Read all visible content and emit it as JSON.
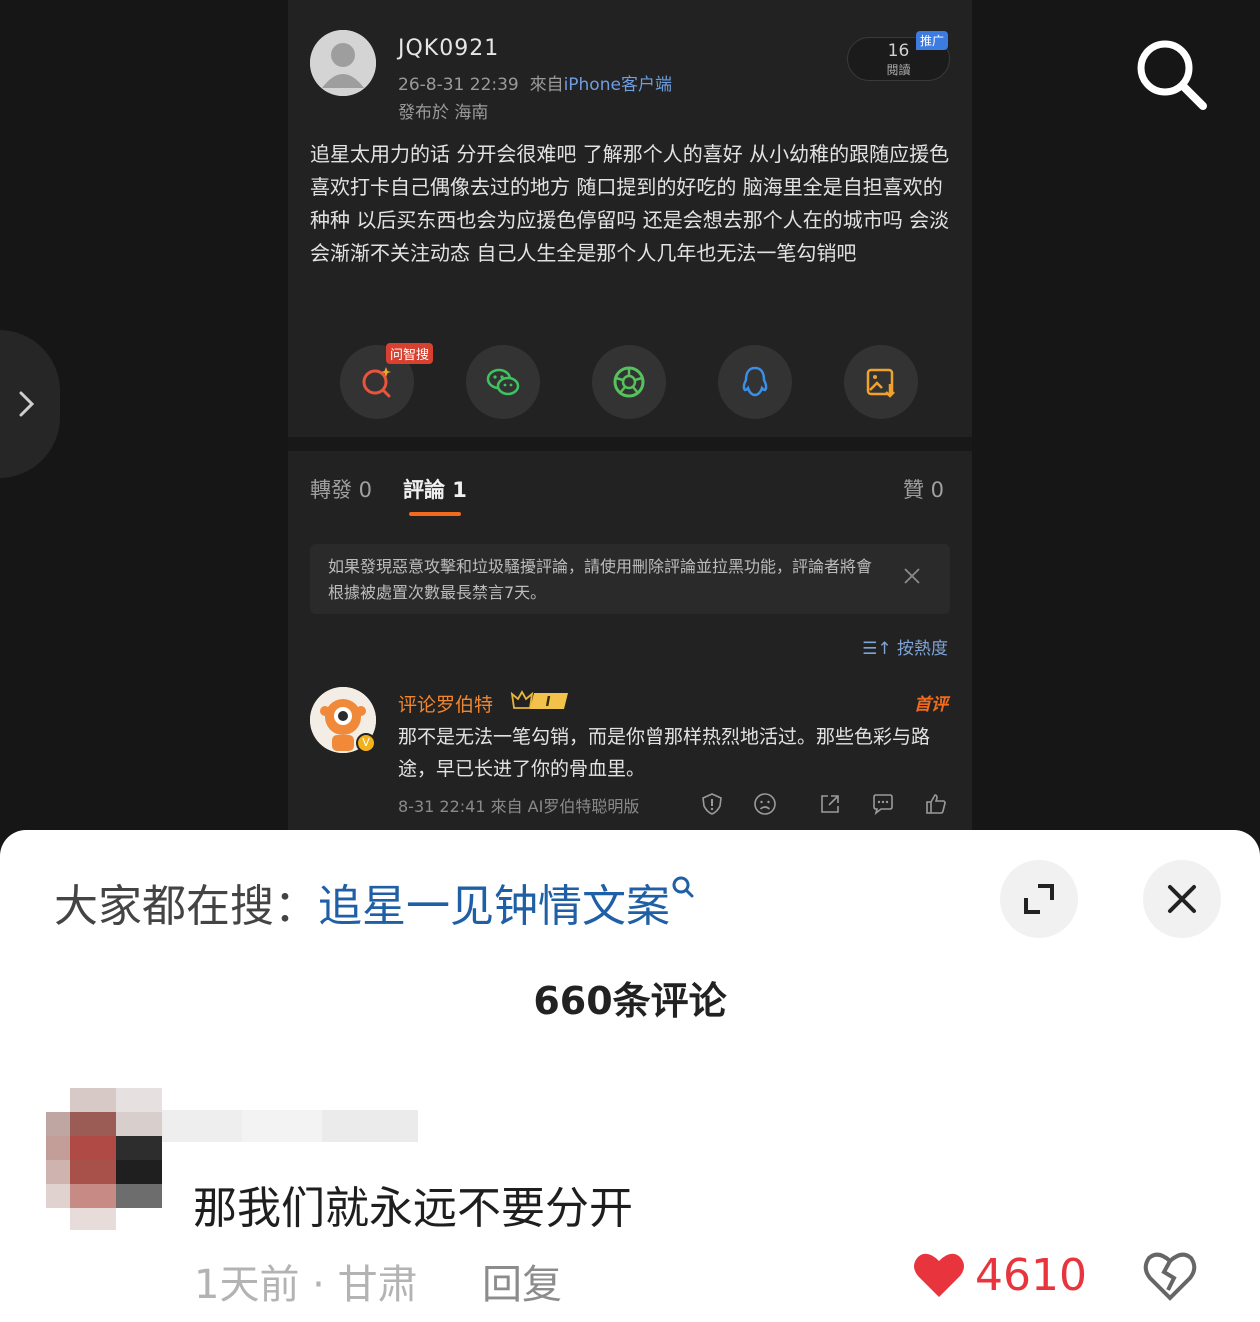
{
  "post": {
    "username": "JQK0921",
    "time": "26-8-31 22:39",
    "from_prefix": "來自",
    "source": "iPhone客户端",
    "location": "發布於 海南",
    "reads_count": "16",
    "reads_label": "閱讀",
    "promo_badge": "推广",
    "body": "追星太用力的话 分开会很难吧 了解那个人的喜好 从小幼稚的跟随应援色 喜欢打卡自己偶像去过的地方 随口提到的好吃的 脑海里全是自担喜欢的种种 以后买东西也会为应援色停留吗 还是会想去那个人在的城市吗 会淡 会渐渐不关注动态 自己人生全是那个人几年也无法一笔勾销吧"
  },
  "share_bar": {
    "zhisou_badge": "问智搜",
    "icons": [
      "ai-search-icon",
      "wechat-icon",
      "moments-icon",
      "qq-icon",
      "save-image-icon"
    ]
  },
  "tabs": {
    "repost": "轉發 0",
    "comments": "評論 1",
    "likes": "贊 0"
  },
  "notice": {
    "text": "如果發現惡意攻擊和垃圾騷擾評論，請使用刪除評論並拉黑功能，評論者將會根據被處置次數最長禁言7天。"
  },
  "sort_label": "按熱度",
  "comment": {
    "name": "评论罗伯特",
    "vip_level": "I",
    "first_badge": "首评",
    "text": "那不是无法一笔勾销，而是你曾那样热烈地活过。那些色彩与路途，早已长进了你的骨血里。",
    "meta": "8-31 22:41 來自 AI罗伯特聪明版",
    "badge_letter": "V"
  },
  "sheet": {
    "hot_prefix": "大家都在搜：",
    "hot_keyword": "追星一见钟情文案",
    "comment_count": "660条评论",
    "top_comment": {
      "text": "那我们就永远不要分开",
      "meta": "1天前 · 甘肃",
      "reply": "回复",
      "likes": "4610"
    }
  },
  "colors": {
    "accent_orange": "#f26a1e",
    "link_blue": "#1f5fa6",
    "like_red": "#e8343c"
  }
}
